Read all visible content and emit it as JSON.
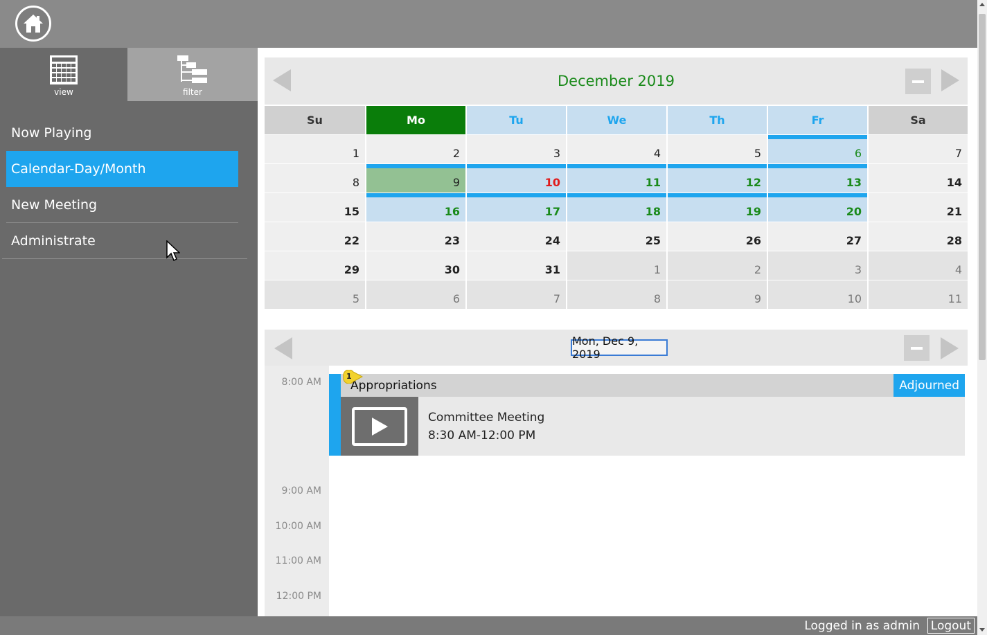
{
  "toolbar": {
    "tabs": [
      {
        "label": "view",
        "icon": "calendar-grid-icon"
      },
      {
        "label": "filter",
        "icon": "tree-list-icon"
      }
    ]
  },
  "sidebar": {
    "items": [
      {
        "label": "Now Playing"
      },
      {
        "label": "Calendar-Day/Month",
        "active": true
      },
      {
        "label": "New Meeting"
      },
      {
        "label": "Administrate"
      }
    ]
  },
  "calendar": {
    "title": "December 2019",
    "days_of_week": [
      "Su",
      "Mo",
      "Tu",
      "We",
      "Th",
      "Fr",
      "Sa"
    ],
    "weeks": [
      [
        "1",
        "2",
        "3",
        "4",
        "5",
        "6",
        "7"
      ],
      [
        "8",
        "9",
        "10",
        "11",
        "12",
        "13",
        "14"
      ],
      [
        "15",
        "16",
        "17",
        "18",
        "19",
        "20",
        "21"
      ],
      [
        "22",
        "23",
        "24",
        "25",
        "26",
        "27",
        "28"
      ],
      [
        "29",
        "30",
        "31",
        "1",
        "2",
        "3",
        "4"
      ],
      [
        "5",
        "6",
        "7",
        "8",
        "9",
        "10",
        "11"
      ]
    ]
  },
  "day_view": {
    "date": "Mon, Dec 9, 2019",
    "times": [
      "8:00 AM",
      "9:00 AM",
      "10:00 AM",
      "11:00 AM",
      "12:00 PM"
    ],
    "event": {
      "badge": "1",
      "title": "Appropriations",
      "status": "Adjourned",
      "type": "Committee Meeting",
      "time": "8:30 AM-12:00 PM"
    }
  },
  "footer": {
    "logged_in": "Logged in as admin",
    "logout": "Logout"
  },
  "colors": {
    "accent": "#1ea5ee",
    "green": "#1a8a1a",
    "today": "#0a7d0a",
    "selected_day": "#93c193",
    "week_highlight": "#c7def0",
    "red": "#e01b1b"
  }
}
